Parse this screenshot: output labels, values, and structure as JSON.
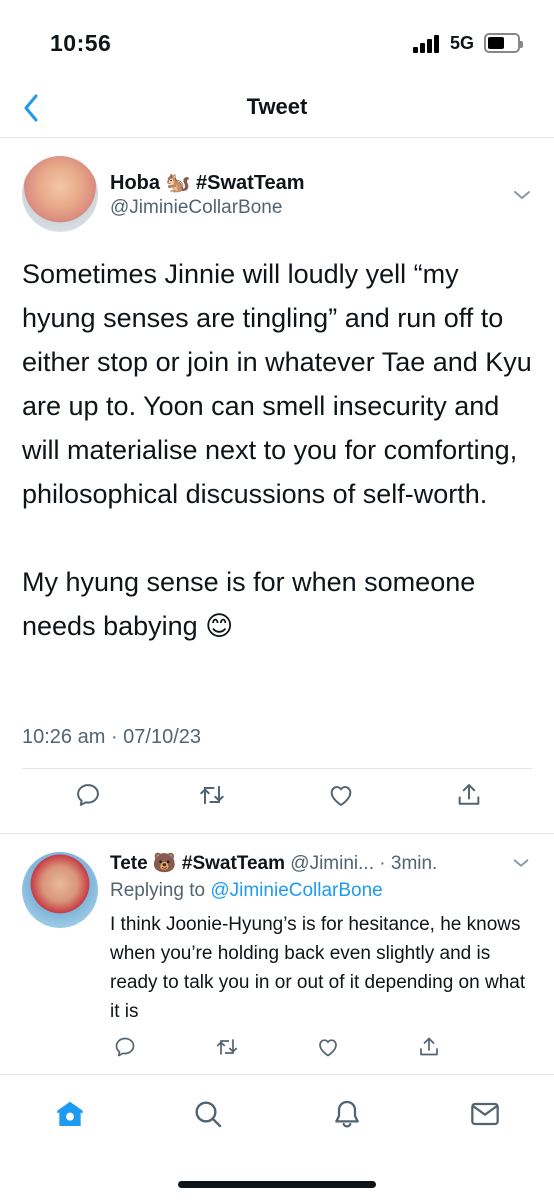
{
  "status_bar": {
    "time": "10:56",
    "network": "5G",
    "battery": "50"
  },
  "header": {
    "title": "Tweet"
  },
  "tweet": {
    "author_name": "Hoba 🐿️ #SwatTeam",
    "author_handle": "@JiminieCollarBone",
    "text": "Sometimes Jinnie will loudly yell “my hyung senses are tingling” and run off to either stop or join in whatever Tae and Kyu are up to. Yoon can smell insecurity and will materialise next to you for comforting, philosophical discussions of self-worth.\n\nMy hyung sense is for when someone needs babying 😊",
    "timestamp": "10:26 am · 07/10/23",
    "actions": [
      "reply-icon",
      "retweet-icon",
      "like-icon",
      "share-icon"
    ]
  },
  "reply": {
    "author_name": "Tete 🐻 #SwatTeam",
    "author_handle": "@Jimini...",
    "time": "· 3min.",
    "replying_prefix": "Replying to ",
    "replying_to": "@JiminieCollarBone",
    "text": "I think Joonie-Hyung’s is for hesitance, he knows when you’re holding back even slightly and is ready to talk you in or out of it depending on what it is"
  },
  "tab_bar": {
    "tabs": [
      "home-icon",
      "search-icon",
      "notifications-icon",
      "messages-icon"
    ],
    "accent": "#1d9bf0"
  },
  "colors": {
    "accent": "#1d9bf0",
    "secondary_text": "#536471",
    "divider": "#e1e8ed"
  }
}
